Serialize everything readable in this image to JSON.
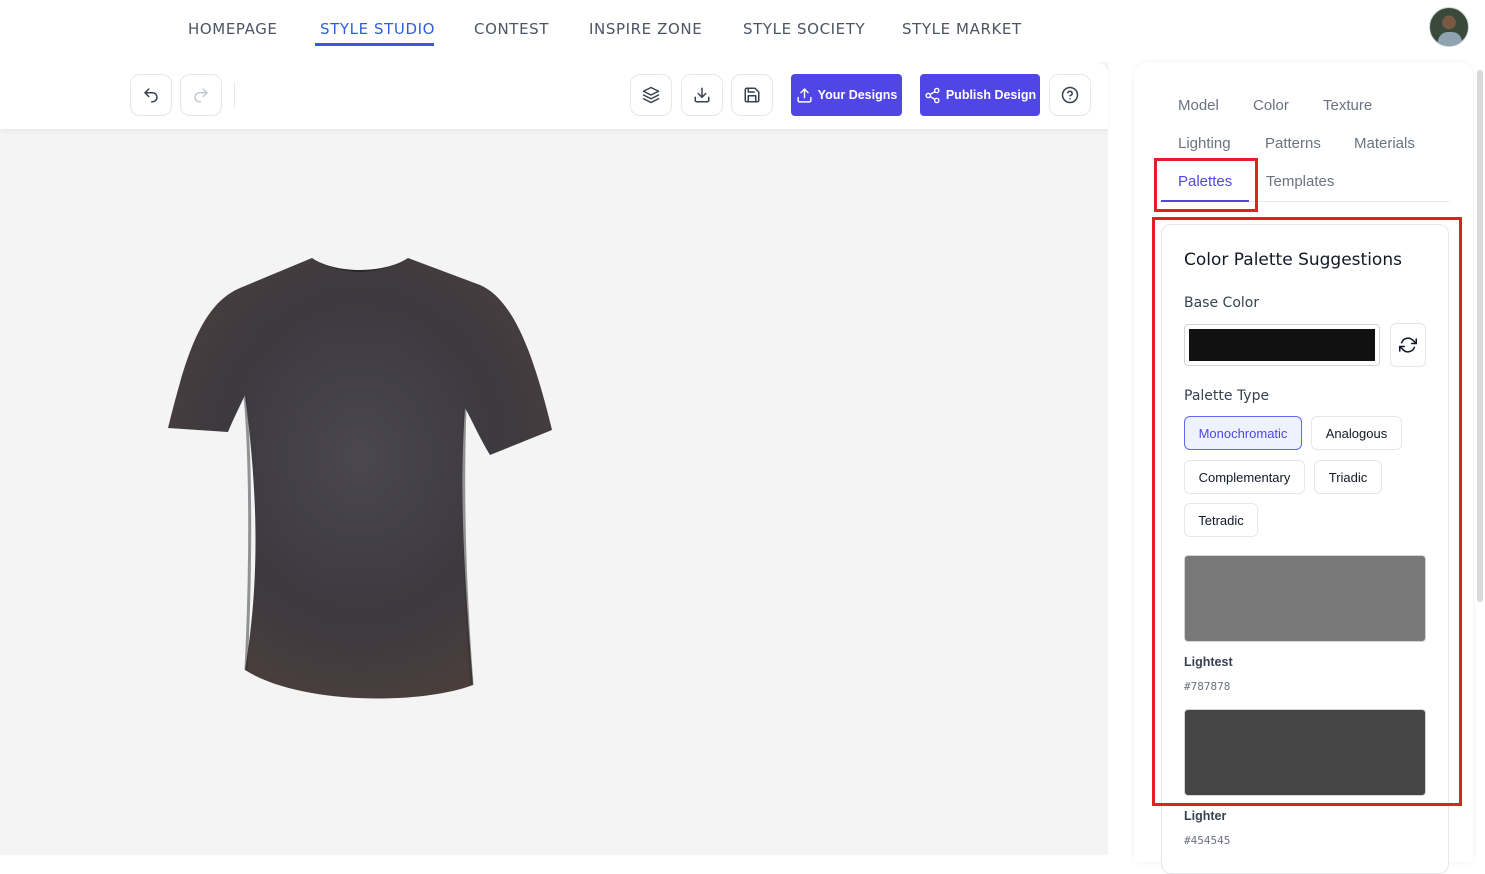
{
  "nav": {
    "items": [
      {
        "label": "HOMEPAGE"
      },
      {
        "label": "STYLE STUDIO"
      },
      {
        "label": "CONTEST"
      },
      {
        "label": "INSPIRE ZONE"
      },
      {
        "label": "STYLE SOCIETY"
      },
      {
        "label": "STYLE MARKET"
      }
    ],
    "active": "STYLE STUDIO"
  },
  "toolbar": {
    "your_designs_label": "Your Designs",
    "publish_label": "Publish Design",
    "icons": [
      "undo-icon",
      "redo-icon",
      "layers-icon",
      "download-icon",
      "save-icon",
      "upload-icon",
      "share-icon",
      "help-icon"
    ]
  },
  "panel": {
    "tabs": [
      "Model",
      "Color",
      "Texture",
      "Lighting",
      "Patterns",
      "Materials",
      "Palettes",
      "Templates"
    ],
    "active_tab": "Palettes",
    "title": "Color Palette Suggestions",
    "base_color_label": "Base Color",
    "base_color": "#111111",
    "palette_type_label": "Palette Type",
    "palette_types": [
      "Monochromatic",
      "Analogous",
      "Complementary",
      "Triadic",
      "Tetradic"
    ],
    "selected_palette_type": "Monochromatic",
    "swatches": [
      {
        "name": "Lightest",
        "hex": "#787878"
      },
      {
        "name": "Lighter",
        "hex": "#454545"
      }
    ]
  },
  "colors": {
    "accent": "#4f46e5",
    "nav_active": "#2f5fd8",
    "highlight": "#e31e24",
    "shirt": "#3f3d42"
  }
}
